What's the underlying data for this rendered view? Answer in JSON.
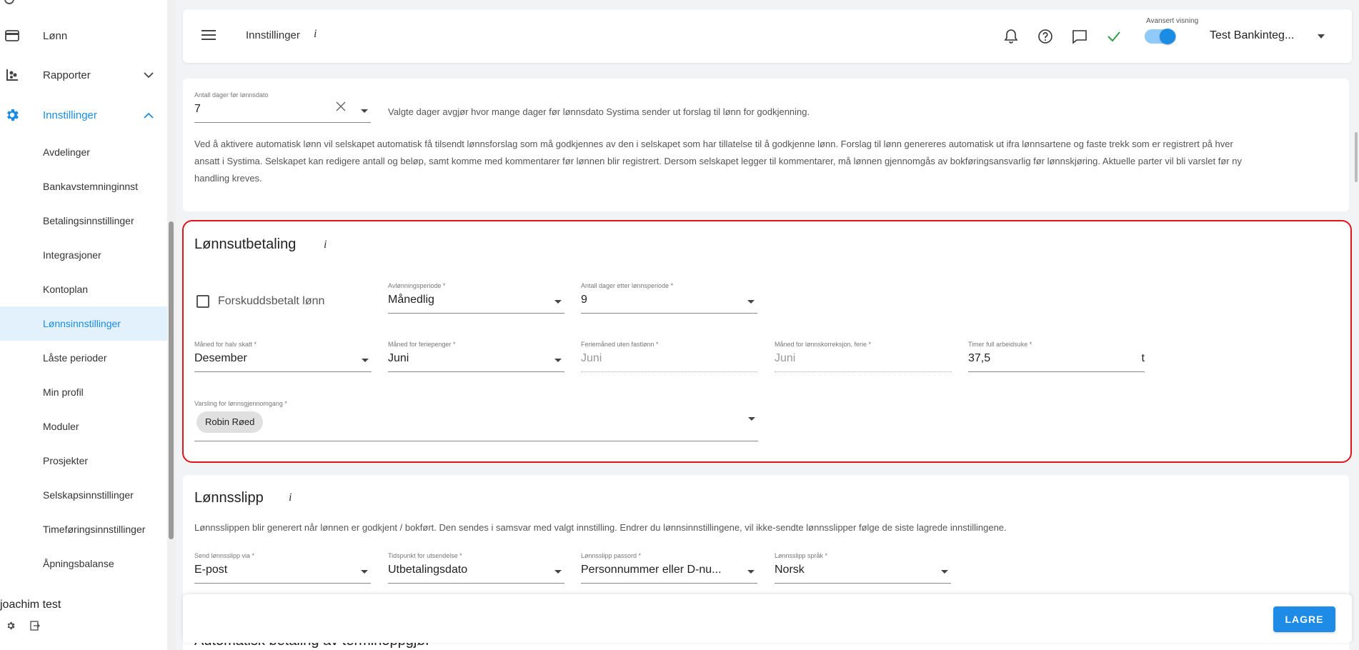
{
  "sidebar": {
    "main_items": [
      {
        "label": "Lønn",
        "icon": "credit-card-icon"
      },
      {
        "label": "Rapporter",
        "icon": "reports-icon"
      },
      {
        "label": "Innstillinger",
        "icon": "gear-icon"
      }
    ],
    "sub_items": [
      {
        "label": "Avdelinger"
      },
      {
        "label": "Bankavstemninginnst"
      },
      {
        "label": "Betalingsinnstillinger"
      },
      {
        "label": "Integrasjoner"
      },
      {
        "label": "Kontoplan"
      },
      {
        "label": "Lønnsinnstillinger"
      },
      {
        "label": "Låste perioder"
      },
      {
        "label": "Min profil"
      },
      {
        "label": "Moduler"
      },
      {
        "label": "Prosjekter"
      },
      {
        "label": "Selskapsinnstillinger"
      },
      {
        "label": "Timeføringsinnstillinger"
      },
      {
        "label": "Åpningsbalanse"
      }
    ],
    "user_name": "joachim test"
  },
  "header": {
    "title": "Innstillinger",
    "info": "i",
    "advanced_label": "Avansert visning",
    "company": "Test Bankinteg..."
  },
  "card1": {
    "days_label": "Antall dager før lønnsdato",
    "days_value": "7",
    "days_help": "Valgte dager avgjør hvor mange dager før lønnsdato Systima sender ut forslag til lønn for godkjenning.",
    "description_lines": [
      "Ved å aktivere automatisk lønn vil selskapet automatisk få tilsendt lønnsforslag som må godkjennes av den i selskapet som har tillatelse til å godkjenne lønn. Forslag til lønn genereres automatisk ut ifra lønnsartene og faste trekk som er registrert på hver",
      "ansatt i Systima. Selskapet kan redigere antall og beløp, samt komme med kommentarer før lønnen blir registrert. Dersom selskapet legger til kommentarer, må lønnen gjennomgås av bokføringsansvarlig før lønnskjøring. Aktuelle parter vil bli varslet før ny",
      "handling kreves."
    ]
  },
  "payout": {
    "title": "Lønnsutbetaling",
    "info": "i",
    "prepaid_label": "Forskuddsbetalt lønn",
    "prepaid_checked": false,
    "period_label": "Avlønningsperiode *",
    "period_value": "Månedlig",
    "days_after_label": "Antall dager etter lønnsperiode *",
    "days_after_value": "9",
    "half_tax_label": "Måned for halv skatt *",
    "half_tax_value": "Desember",
    "holiday_pay_label": "Måned for feriepenger *",
    "holiday_pay_value": "Juni",
    "holiday_month_label": "Feriemåned uten fastlønn *",
    "holiday_month_value": "Juni",
    "correction_label": "Måned for lønnskorreksjon, ferie *",
    "correction_value": "Juni",
    "hours_label": "Timer full arbeidsuke *",
    "hours_value": "37,5",
    "hours_unit": "t",
    "notify_label": "Varsling for lønnsgjennomgang *",
    "notify_chip": "Robin Røed"
  },
  "payslip": {
    "title": "Lønnsslipp",
    "info": "i",
    "description": "Lønnsslippen blir generert når lønnen er godkjent / bokført. Den sendes i samsvar med valgt innstilling. Endrer du lønnsinnstillingene, vil ikke-sendte lønnsslipper følge de siste lagrede innstillingene.",
    "send_label": "Send lønnsslipp via *",
    "send_value": "E-post",
    "time_label": "Tidspunkt for utsendelse *",
    "time_value": "Utbetalingsdato",
    "password_label": "Lønnsslipp passord *",
    "password_value": "Personnummer eller D-nu...",
    "language_label": "Lønnsslipp språk *",
    "language_value": "Norsk"
  },
  "next_section_title": "Automatisk betaling av terminoppgjør",
  "save_label": "LAGRE",
  "colors": {
    "accent": "#1a8ce3",
    "highlight_border": "#e0161c",
    "selected_bg": "#e3f1fc",
    "check_green": "#2e9e4a"
  }
}
